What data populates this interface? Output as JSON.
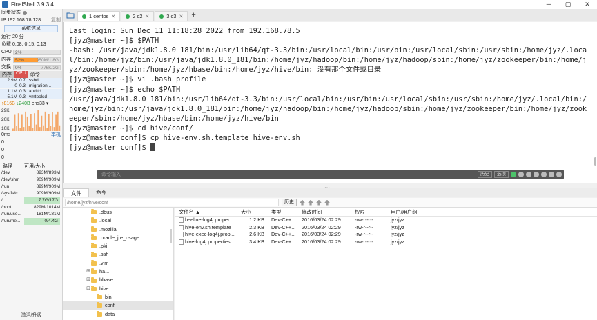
{
  "window": {
    "title": "FinalShell 3.9.3.4",
    "controls": [
      "─",
      "▢",
      "✕"
    ]
  },
  "left": {
    "sync_label": "同步状态",
    "ip": "IP 192.168.78.128",
    "copy": "复制",
    "sysinfo": "系统信息",
    "uptime": "运行 20 分",
    "load": "负载 0.08, 0.15, 0.13",
    "cpu": {
      "label": "CPU",
      "pct": "2%",
      "fraction": 0.02
    },
    "mem": {
      "label": "内存",
      "pct": "52%",
      "val": "950M/1.8G",
      "fraction": 0.52
    },
    "swap": {
      "label": "交换",
      "pct": "0%",
      "val": "776K/2G",
      "fraction": 0.0
    },
    "proc_tabs": {
      "mem": "内存",
      "cpu": "CPU",
      "cmd": "命令"
    },
    "processes": [
      {
        "mem": "2.9M",
        "cpu": "0.7",
        "cmd": "sshd"
      },
      {
        "mem": "0",
        "cpu": "0.3",
        "cmd": "migration..."
      },
      {
        "mem": "1.1M",
        "cpu": "0.3",
        "cmd": "auditd"
      },
      {
        "mem": "5.1M",
        "cpu": "0.3",
        "cmd": "vmtoolsd"
      }
    ],
    "net": {
      "up": "↑816B",
      "down": "↓240B",
      "iface": "ens33",
      "y_ticks": [
        "29K",
        "20K",
        "10K"
      ],
      "samples": [
        3,
        20,
        6,
        22,
        4,
        20,
        5,
        24,
        18,
        6,
        21,
        4,
        22,
        8,
        26,
        5,
        19,
        7,
        24,
        4,
        21,
        6,
        23,
        5,
        20,
        24,
        7
      ]
    },
    "latency": {
      "value": "0ms",
      "machine": "本机",
      "samples": [
        "0",
        "0",
        "0"
      ]
    },
    "disk_head": {
      "path": "路径",
      "size": "可用/大小"
    },
    "disks": [
      {
        "path": "/dev",
        "size": "893M/893M"
      },
      {
        "path": "/dev/shm",
        "size": "909M/909M"
      },
      {
        "path": "/run",
        "size": "899M/909M"
      },
      {
        "path": "/sys/fs/c...",
        "size": "909M/909M"
      },
      {
        "path": "/",
        "size": "7.7G/17G",
        "hl": true
      },
      {
        "path": "/boot",
        "size": "829M/1014M"
      },
      {
        "path": "/run/use...",
        "size": "181M/181M"
      },
      {
        "path": "/run/me...",
        "size": "0/4.4G",
        "hl": true
      }
    ],
    "upgrade": "激活/升级"
  },
  "tabs": [
    {
      "label": "1 centos",
      "active": true
    },
    {
      "label": "2 c2",
      "active": false
    },
    {
      "label": "3 c3",
      "active": false
    }
  ],
  "terminal": {
    "lines": [
      "Last login: Sun Dec 11 11:18:28 2022 from 192.168.78.5",
      "[jyz@master ~]$ $PATH",
      "-bash: /usr/java/jdk1.8.0_181/bin:/usr/lib64/qt-3.3/bin:/usr/local/bin:/usr/bin:/usr/local/sbin:/usr/sbin:/home/jyz/.loca",
      "l/bin:/home/jyz/bin:/usr/java/jdk1.8.0_181/bin:/home/jyz/hadoop/bin:/home/jyz/hadoop/sbin:/home/jyz/zookeeper/bin:/home/j",
      "yz/zookeeper/sbin:/home/jyz/hbase/bin:/home/jyz/hive/bin: 没有那个文件或目录",
      "[jyz@master ~]$ vi .bash_profile",
      "[jyz@master ~]$ echo $PATH",
      "/usr/java/jdk1.8.0_181/bin:/usr/lib64/qt-3.3/bin:/usr/local/bin:/usr/bin:/usr/local/sbin:/usr/sbin:/home/jyz/.local/bin:/",
      "home/jyz/bin:/usr/java/jdk1.8.0_181/bin:/home/jyz/hadoop/bin:/home/jyz/hadoop/sbin:/home/jyz/zookeeper/bin:/home/jyz/zook",
      "eeper/sbin:/home/jyz/hbase/bin:/home/jyz/hive/bin",
      "[jyz@master ~]$ cd hive/conf/",
      "[jyz@master conf]$ cp hive-env.sh.template hive-env.sh",
      "[jyz@master conf]$ "
    ],
    "cmd_placeholder": "命令输入",
    "history_btn": "历史",
    "options_btn": "选项"
  },
  "bottom_tabs": {
    "files": "文件",
    "commands": "命令"
  },
  "pathbar": {
    "path": "/home/jyz/hive/conf",
    "history": "历史"
  },
  "tree": [
    {
      "name": ".dbus",
      "indent": 3,
      "exp": ""
    },
    {
      "name": ".local",
      "indent": 3,
      "exp": ""
    },
    {
      "name": ".mozilla",
      "indent": 3,
      "exp": ""
    },
    {
      "name": ".oracle_jre_usage",
      "indent": 3,
      "exp": ""
    },
    {
      "name": ".pki",
      "indent": 3,
      "exp": ""
    },
    {
      "name": ".ssh",
      "indent": 3,
      "exp": ""
    },
    {
      "name": ".vim",
      "indent": 3,
      "exp": ""
    },
    {
      "name": "ha...",
      "indent": 3,
      "exp": "⊞"
    },
    {
      "name": "hbase",
      "indent": 3,
      "exp": "⊞"
    },
    {
      "name": "hive",
      "indent": 3,
      "exp": "⊟"
    },
    {
      "name": "bin",
      "indent": 4,
      "exp": ""
    },
    {
      "name": "conf",
      "indent": 4,
      "exp": "",
      "sel": true
    },
    {
      "name": "data",
      "indent": 4,
      "exp": ""
    }
  ],
  "files": {
    "headers": {
      "name": "文件名 ▲",
      "size": "大小",
      "type": "类型",
      "time": "修改时间",
      "perm": "权限",
      "user": "用户/用户组"
    },
    "rows": [
      {
        "name": "beeline-log4j.proper...",
        "size": "1.2 KB",
        "type": "Dev-C++...",
        "time": "2016/03/24 02:29",
        "perm": "-rw-r--r--",
        "user": "jyz/jyz"
      },
      {
        "name": "hive-env.sh.template",
        "size": "2.3 KB",
        "type": "Dev-C++...",
        "time": "2016/03/24 02:29",
        "perm": "-rw-r--r--",
        "user": "jyz/jyz"
      },
      {
        "name": "hive-exec-log4j.prop...",
        "size": "2.6 KB",
        "type": "Dev-C++...",
        "time": "2016/03/24 02:29",
        "perm": "-rw-r--r--",
        "user": "jyz/jyz"
      },
      {
        "name": "hive-log4j.properties...",
        "size": "3.4 KB",
        "type": "Dev-C++...",
        "time": "2016/03/24 02:29",
        "perm": "-rw-r--r--",
        "user": "jyz/jyz"
      }
    ]
  }
}
